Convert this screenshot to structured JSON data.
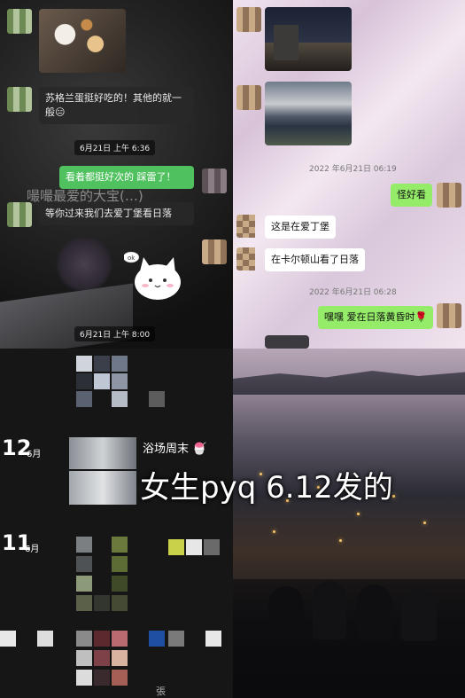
{
  "chat_dark": {
    "msg1": "苏格兰蛋挺好吃的！其他的就一般😑",
    "time1": "6月21日 上午 6:36",
    "msg2": "看着都挺好次的 踩雷了！",
    "bg_text": "嘬嘬最爱的大宝(…)",
    "msg3": "等你过来我们去爱丁堡看日落",
    "sticker_text": "ok",
    "time2": "6月21日 上午 8:00"
  },
  "chat_light": {
    "time1": "2022 年6月21日 06:19",
    "msg_out1": "怪好看",
    "msg_in1": "这是在爱丁堡",
    "msg_in2": "在卡尔顿山看了日落",
    "time2": "2022 年6月21日 06:28",
    "msg_out2": "嘿嘿 爱在日落黄昏时🌹"
  },
  "moments": {
    "day1": "12",
    "mon1": "6月",
    "caption1": "浴场周末 🍧",
    "day2": "11",
    "mon2": "6月",
    "bottom_fragment": "張"
  },
  "overlay_text": "女生pyq 6.12发的",
  "colors": {
    "green_bubble": "#4fc15e",
    "light_green_bubble": "#95ec69"
  }
}
